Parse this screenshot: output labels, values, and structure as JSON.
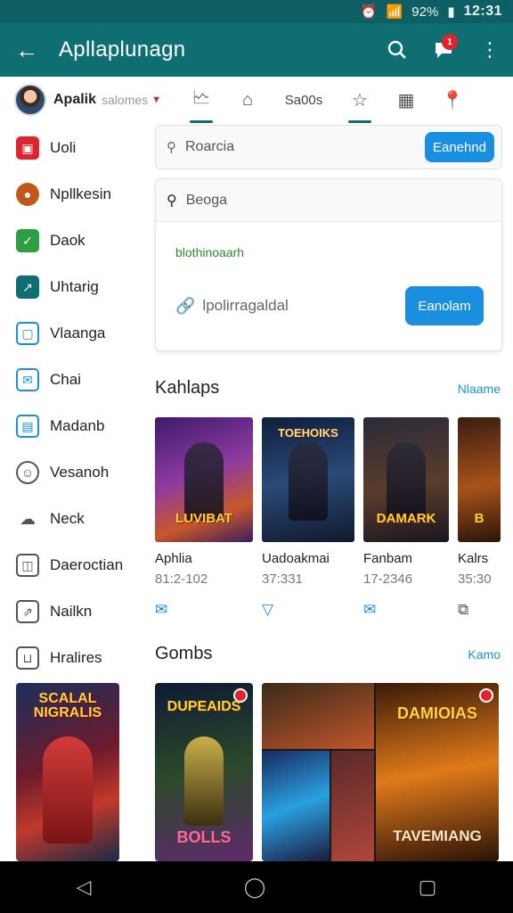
{
  "status_bar": {
    "battery": "92%",
    "time": "12:31"
  },
  "app_bar": {
    "title": "Apllaplunagn",
    "notification_count": "1"
  },
  "profile": {
    "name": "Apalik",
    "sub": "salomes"
  },
  "tabs": {
    "text_tab": "Sa00s"
  },
  "sidebar": {
    "items": [
      {
        "label": "Uoli",
        "icon": "app-icon",
        "color": "#e0242f"
      },
      {
        "label": "Npllkesin",
        "icon": "game-avatar-icon",
        "color": "#c2571a"
      },
      {
        "label": "Daok",
        "icon": "check-icon",
        "color": "#2e9e44"
      },
      {
        "label": "Uhtarig",
        "icon": "chart-icon",
        "color": "#0f6e72"
      },
      {
        "label": "Vlaanga",
        "icon": "frame-icon",
        "color": "#1a8fe0"
      },
      {
        "label": "Chai",
        "icon": "mail-icon",
        "color": "#1a8fe0"
      },
      {
        "label": "Madanb",
        "icon": "calendar-icon",
        "color": "#1a8fe0"
      },
      {
        "label": "Vesanoh",
        "icon": "face-icon",
        "color": "#555555"
      },
      {
        "label": "Neck",
        "icon": "cloud-icon",
        "color": "#555555"
      },
      {
        "label": "Daeroctian",
        "icon": "box-icon",
        "color": "#555555"
      },
      {
        "label": "Nailkn",
        "icon": "share-icon",
        "color": "#555555"
      },
      {
        "label": "Hralires",
        "icon": "bag-icon",
        "color": "#555555"
      }
    ]
  },
  "search1": {
    "placeholder": "Roarcia",
    "button": "Eanehnd"
  },
  "search2": {
    "placeholder": "Beoga",
    "hint": "blothinoaarh",
    "field": "lpolirragaldal",
    "button": "Eanolam"
  },
  "section1": {
    "title": "Kahlaps",
    "more": "Nlaame"
  },
  "section2": {
    "title": "Gombs",
    "more": "Kamo"
  },
  "games": [
    {
      "name": "Aphlia",
      "number": "81:2-102",
      "art_text": "LUVIBAT"
    },
    {
      "name": "Uadoakmai",
      "number": "37:331",
      "art_text": "TOEHOIKS"
    },
    {
      "name": "Fanbam",
      "number": "17-2346",
      "art_text": "DAMARK"
    },
    {
      "name": "Kalrs",
      "number": "35:30",
      "art_text": "B"
    }
  ],
  "banners": {
    "side": "SCALAL NIGRALIS",
    "b1_top": "DUPEAIDS",
    "b1_bottom": "BOLLS",
    "b2_top": "DAMIOIAS",
    "b2_bottom": "TAVEMIANG"
  },
  "colors": {
    "primary": "#0f6e72",
    "accent": "#1a8fe0",
    "badge": "#e0242f"
  }
}
